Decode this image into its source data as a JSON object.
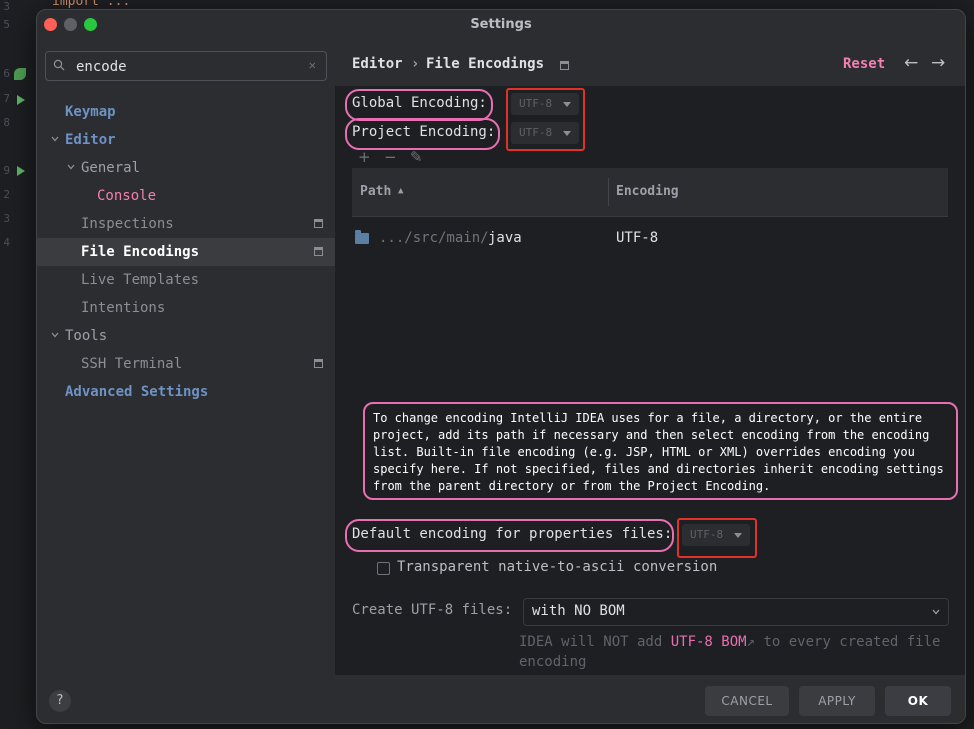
{
  "window": {
    "title": "Settings"
  },
  "background_editor": {
    "code_text": "import ...",
    "line_numbers": [
      "3",
      "5",
      "6",
      "7",
      "8",
      "9",
      "2",
      "3",
      "4"
    ]
  },
  "search": {
    "value": "encode",
    "placeholder": ""
  },
  "sidebar": {
    "items": [
      {
        "label": "Keymap"
      },
      {
        "label": "Editor"
      },
      {
        "label": "General"
      },
      {
        "label": "Console"
      },
      {
        "label": "Inspections"
      },
      {
        "label": "File Encodings"
      },
      {
        "label": "Live Templates"
      },
      {
        "label": "Intentions"
      },
      {
        "label": "Tools"
      },
      {
        "label": "SSH Terminal"
      },
      {
        "label": "Advanced Settings"
      }
    ],
    "help_label": "?"
  },
  "header": {
    "breadcrumb_parent": "Editor",
    "breadcrumb_separator": "›",
    "breadcrumb_current": "File Encodings",
    "reset_label": "Reset",
    "back_arrow": "←",
    "forward_arrow": "→"
  },
  "encodings": {
    "global_label": "Global Encoding:",
    "global_value": "UTF-8",
    "project_label": "Project Encoding:",
    "project_value": "UTF-8"
  },
  "table_toolbar": {
    "add": "+",
    "remove": "−",
    "edit": "✎"
  },
  "table": {
    "columns": [
      "Path",
      "Encoding"
    ],
    "sort_indicator": "▲",
    "rows": [
      {
        "path_prefix": ".../src/main/",
        "path_name": "java",
        "encoding": "UTF-8"
      }
    ]
  },
  "info": {
    "lines": [
      "To change encoding IntelliJ IDEA uses for a file, a directory, or the entire",
      "project, add its path if necessary and then select encoding from the encoding",
      "list. Built-in file encoding (e.g. JSP, HTML or XML) overrides encoding you",
      "specify here. If not specified, files and directories inherit encoding settings",
      "from the parent directory or from the Project Encoding."
    ]
  },
  "properties": {
    "label": "Default encoding for properties files:",
    "value": "UTF-8",
    "checkbox_label": "Transparent native-to-ascii conversion",
    "checkbox_checked": false
  },
  "bom": {
    "label": "Create UTF-8 files:",
    "value": "with NO BOM",
    "hint_prefix": "IDEA will NOT add ",
    "hint_link": "UTF-8 BOM",
    "hint_link_icon": "↗",
    "hint_suffix": " to every created file",
    "hint_line2": "encoding"
  },
  "footer": {
    "cancel": "CANCEL",
    "apply": "APPLY",
    "ok": "OK"
  },
  "colors": {
    "accent_pink": "#e86fb1",
    "reset_pink": "#f280b3",
    "highlight_red": "#e0312a",
    "background": "#1e1f22",
    "panel": "#2b2d30"
  }
}
